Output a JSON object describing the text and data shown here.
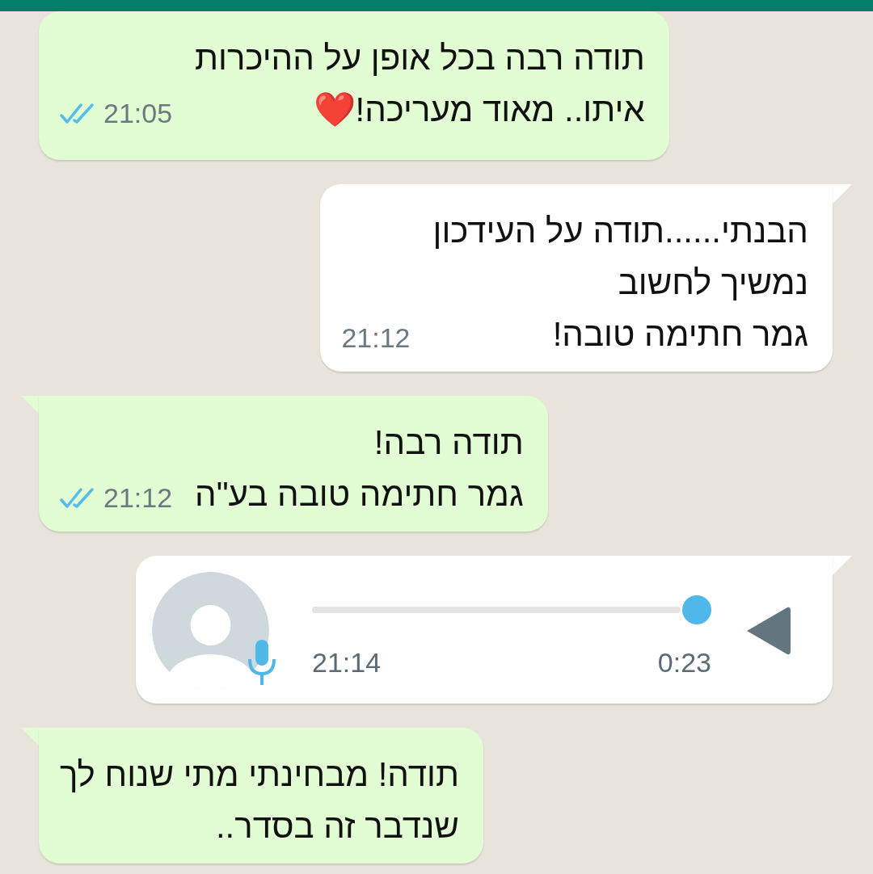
{
  "messages": [
    {
      "kind": "text",
      "outgoing": true,
      "tail": false,
      "text": "תודה רבה בכל אופן על ההיכרות\nאיתו.. מאוד מעריכה!❤️",
      "time": "21:05",
      "read": true
    },
    {
      "kind": "text",
      "outgoing": false,
      "tail": true,
      "text": "הבנתי......תודה על העידכון\nנמשיך לחשוב\nגמר חתימה טובה!",
      "time": "21:12"
    },
    {
      "kind": "text",
      "outgoing": true,
      "tail": true,
      "text": "תודה רבה!\nגמר חתימה טובה בע\"ה",
      "time": "21:12",
      "read": true
    },
    {
      "kind": "voice",
      "outgoing": false,
      "tail": true,
      "time": "21:14",
      "duration": "0:23"
    },
    {
      "kind": "text",
      "outgoing": true,
      "tail": true,
      "text": "תודה! מבחינתי מתי שנוח לך\nשנדבר זה בסדר.."
    }
  ]
}
